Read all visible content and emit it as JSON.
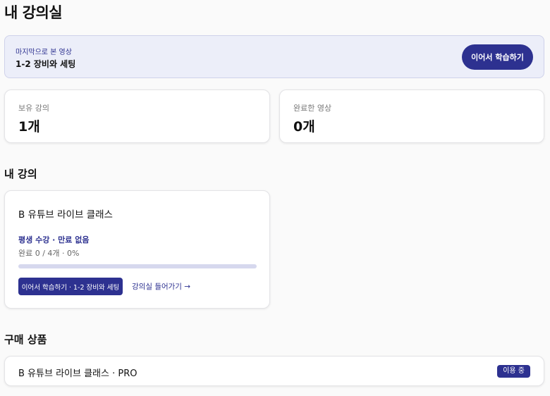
{
  "page": {
    "title": "내 강의실"
  },
  "resume": {
    "kicker": "마지막으로 본 영상",
    "title": "1-2 장비와 세팅",
    "button_label": "이어서 학습하기"
  },
  "stats": [
    {
      "label": "보유 강의",
      "value": "1개"
    },
    {
      "label": "완료한 영상",
      "value": "0개"
    }
  ],
  "sections": {
    "my_courses": "내 강의",
    "purchases": "구매 상품"
  },
  "course": {
    "title": "B 유튜브 라이브 클래스",
    "access": "평생 수강 · 만료 없음",
    "progress_text": "완료 0 / 4개 · 0%",
    "progress_fraction": 0,
    "continue_label": "이어서 학습하기 · 1-2 장비와 세팅",
    "enter_label": "강의실 들어가기 →"
  },
  "product": {
    "name": "B 유튜브 라이브 클래스 · PRO",
    "status": "이용 중"
  },
  "colors": {
    "accent": "#2d3190",
    "banner_bg": "#eceef9",
    "progress_track": "#d6d8ee"
  }
}
